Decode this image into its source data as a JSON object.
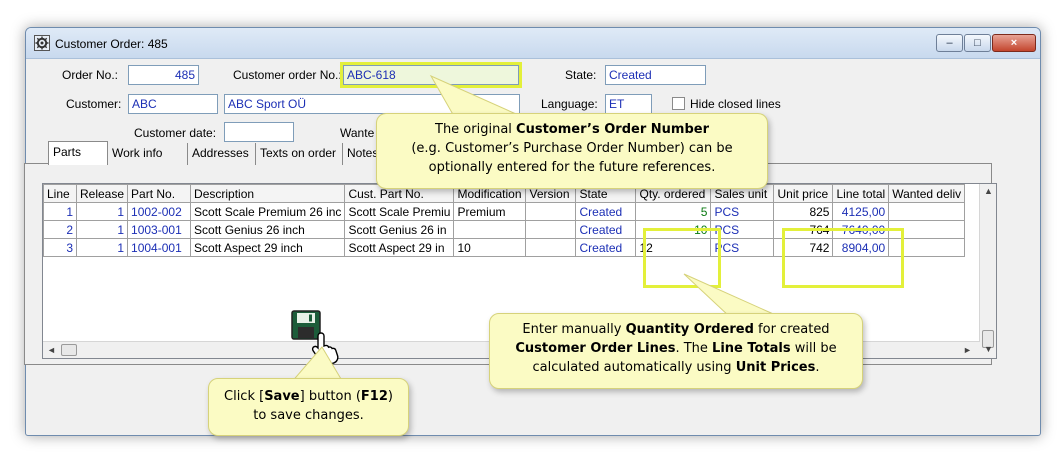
{
  "window": {
    "title": "Customer Order: 485",
    "controls": {
      "minimize": "–",
      "maximize": "□",
      "close": "×"
    }
  },
  "header": {
    "order_no_label": "Order No.:",
    "order_no": "485",
    "customer_order_no_label": "Customer order No.:",
    "customer_order_no": "ABC-618",
    "state_label": "State:",
    "state": "Created",
    "customer_label": "Customer:",
    "customer_code": "ABC",
    "customer_name": "ABC Sport OÜ",
    "language_label": "Language:",
    "language": "ET",
    "hide_closed_label": "Hide closed lines",
    "customer_date_label": "Customer date:",
    "customer_date": "",
    "wanted_label": "Wante"
  },
  "tabs": [
    {
      "label": "Parts"
    },
    {
      "label": "Work info"
    },
    {
      "label": "Addresses"
    },
    {
      "label": "Texts on order"
    },
    {
      "label": "Notes"
    }
  ],
  "grid": {
    "columns": [
      "Line",
      "Release",
      "Part No.",
      "Description",
      "Cust. Part No.",
      "Modification",
      "Version",
      "State",
      "Qty. ordered",
      "Sales unit",
      "Unit price",
      "Line total",
      "Wanted deliv"
    ],
    "rows": [
      {
        "line": "1",
        "release": "1",
        "part_no": "1002-002",
        "description": "Scott Scale Premium 26 inc",
        "cust_part_no": "Scott Scale Premiu",
        "modification": "Premium",
        "version": "",
        "state": "Created",
        "qty": "5",
        "unit": "PCS",
        "unit_price": "825",
        "line_total": "4125,00",
        "wanted": ""
      },
      {
        "line": "2",
        "release": "1",
        "part_no": "1003-001",
        "description": "Scott Genius 26 inch",
        "cust_part_no": "Scott Genius 26 in",
        "modification": "",
        "version": "",
        "state": "Created",
        "qty": "10",
        "unit": "PCS",
        "unit_price": "764",
        "line_total": "7640,00",
        "wanted": ""
      },
      {
        "line": "3",
        "release": "1",
        "part_no": "1004-001",
        "description": "Scott Aspect 29 inch",
        "cust_part_no": "Scott Aspect 29 in",
        "modification": "10",
        "version": "",
        "state": "Created",
        "qty": "12",
        "unit": "PCS",
        "unit_price": "742",
        "line_total": "8904,00",
        "wanted": ""
      }
    ]
  },
  "callouts": {
    "order_number": {
      "line1_pre": "The original ",
      "line1_bold": "Customer’s Order Number",
      "line2": "(e.g. Customer’s Purchase Order Number) can be",
      "line3": "optionally entered for the future references."
    },
    "quantity": {
      "l1_pre": "Enter manually ",
      "l1_bold": "Quantity Ordered",
      "l1_post": " for created",
      "l2_bold1": "Customer Order Lines",
      "l2_mid": ".  The ",
      "l2_bold2": "Line Totals",
      "l2_post": " will be",
      "l3_pre": "calculated automatically using ",
      "l3_bold": "Unit Prices",
      "l3_post": "."
    },
    "save": {
      "l1_pre": "Click [",
      "l1_bold": "Save",
      "l1_mid": "] button (",
      "l1_bold2": "F12",
      "l1_post": ")",
      "l2": "to save changes."
    }
  },
  "colors": {
    "highlight": "#e3f03a",
    "callout_bg": "#fbfbc4",
    "value_text": "#1c2fb5"
  }
}
